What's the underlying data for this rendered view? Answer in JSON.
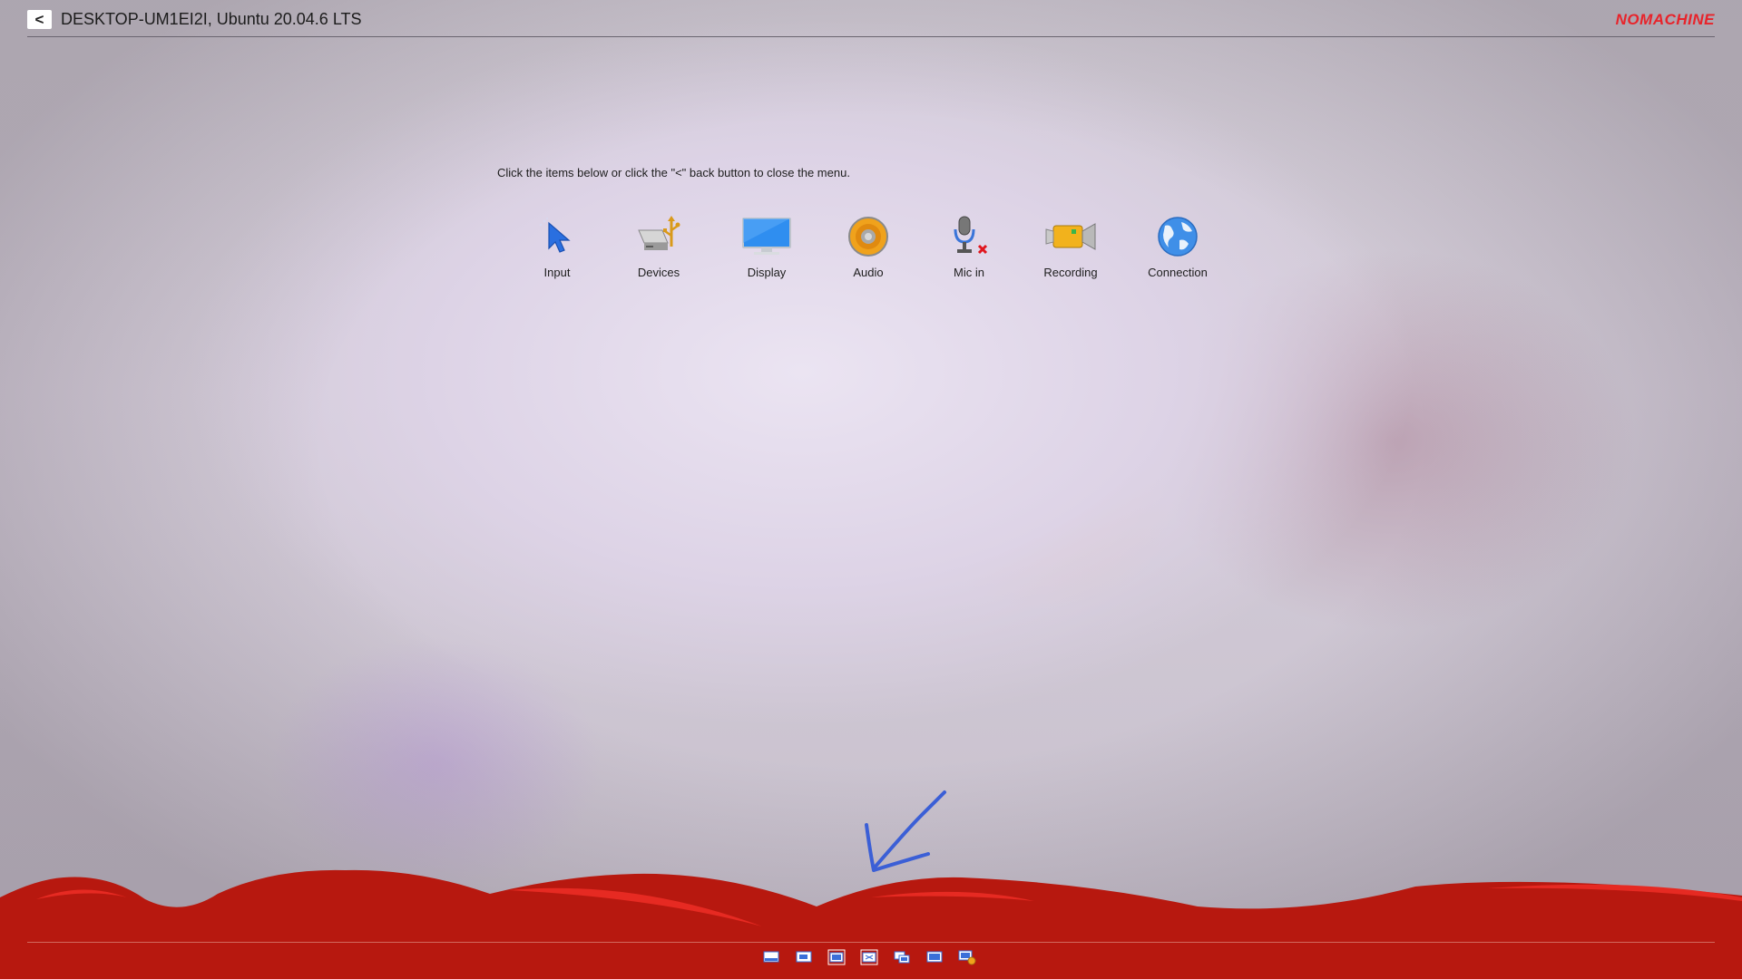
{
  "header": {
    "back_label": "<",
    "session_title": "DESKTOP-UM1EI2I, Ubuntu 20.04.6 LTS",
    "brand": "NOMACHINE",
    "brand_color": "#e8232a"
  },
  "menu": {
    "instruction": "Click the items below or click the \"<\" back button to close the menu.",
    "items": [
      {
        "label": "Input",
        "icon": "pointer-arrow-icon"
      },
      {
        "label": "Devices",
        "icon": "usb-drive-icon"
      },
      {
        "label": "Display",
        "icon": "monitor-icon"
      },
      {
        "label": "Audio",
        "icon": "speaker-icon"
      },
      {
        "label": "Mic in",
        "icon": "microphone-muted-icon"
      },
      {
        "label": "Recording",
        "icon": "video-camera-icon"
      },
      {
        "label": "Connection",
        "icon": "globe-icon"
      }
    ]
  },
  "toolbar": {
    "icons": [
      "fit-to-window-icon",
      "scale-icon",
      "resize-icon",
      "fullscreen-icon",
      "multi-monitor-icon",
      "view-window-icon",
      "display-settings-icon"
    ]
  },
  "colors": {
    "wave_red": "#b7180f",
    "annotation_blue": "#3b5fd6"
  }
}
